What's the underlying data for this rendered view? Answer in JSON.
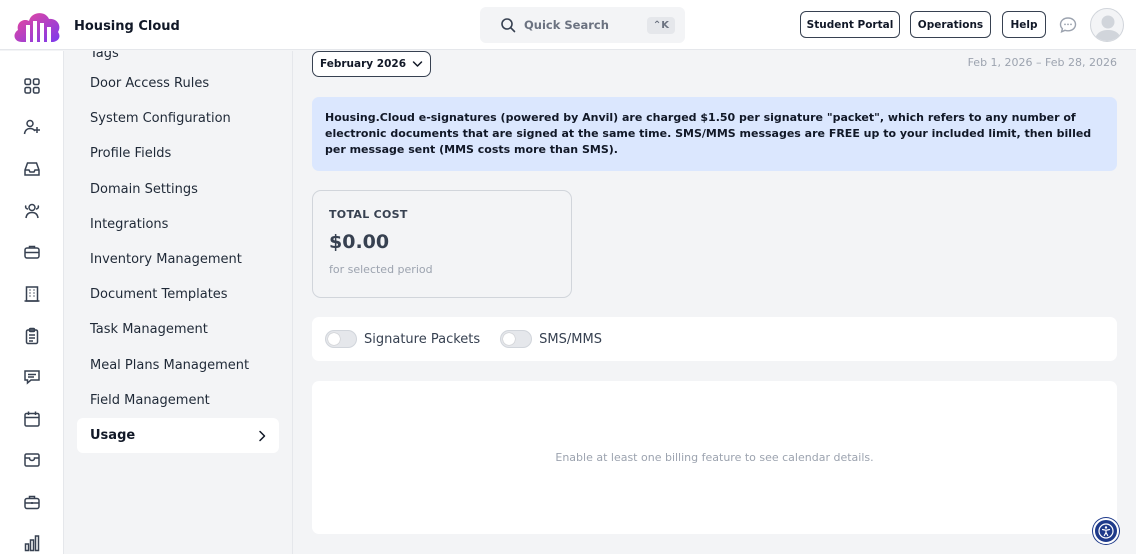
{
  "header": {
    "brand_title": "Housing Cloud",
    "search_label": "Quick Search",
    "search_shortcut": "⌃K",
    "buttons": {
      "student_portal": "Student Portal",
      "operations": "Operations",
      "help": "Help"
    }
  },
  "rail": {
    "icons": [
      "dashboard-icon",
      "add-user-icon",
      "inbox-icon",
      "users-icon",
      "briefcase-icon",
      "building-icon",
      "clipboard-icon",
      "message-icon",
      "calendar-icon",
      "mail-box-icon",
      "toolbox-icon",
      "bar-chart-icon"
    ]
  },
  "sidebar": {
    "partial_top_item": "Tags",
    "items": [
      {
        "label": "Door Access Rules"
      },
      {
        "label": "System Configuration"
      },
      {
        "label": "Profile Fields"
      },
      {
        "label": "Domain Settings"
      },
      {
        "label": "Integrations"
      },
      {
        "label": "Inventory Management"
      },
      {
        "label": "Document Templates"
      },
      {
        "label": "Task Management"
      },
      {
        "label": "Meal Plans Management"
      },
      {
        "label": "Field Management"
      }
    ],
    "active_item": "Usage"
  },
  "main": {
    "month_selector": "February 2026",
    "date_range": "Feb 1, 2026 – Feb 28, 2026",
    "notice": "Housing.Cloud e-signatures (powered by Anvil) are charged $1.50 per signature \"packet\", which refers to any number of electronic documents that are signed at the same time. SMS/MMS messages are FREE up to your included limit, then billed per message sent (MMS costs more than SMS).",
    "cost_card": {
      "label": "TOTAL COST",
      "value": "$0.00",
      "sub": "for selected period"
    },
    "toggles": [
      {
        "label": "Signature Packets",
        "on": false
      },
      {
        "label": "SMS/MMS",
        "on": false
      }
    ],
    "calendar_message": "Enable at least one billing feature to see calendar details."
  },
  "colors": {
    "accent": "#1e3a8a",
    "notice_bg": "#dbe7fe",
    "logo_pink": "#ec4899",
    "logo_purple": "#7c3aed"
  }
}
